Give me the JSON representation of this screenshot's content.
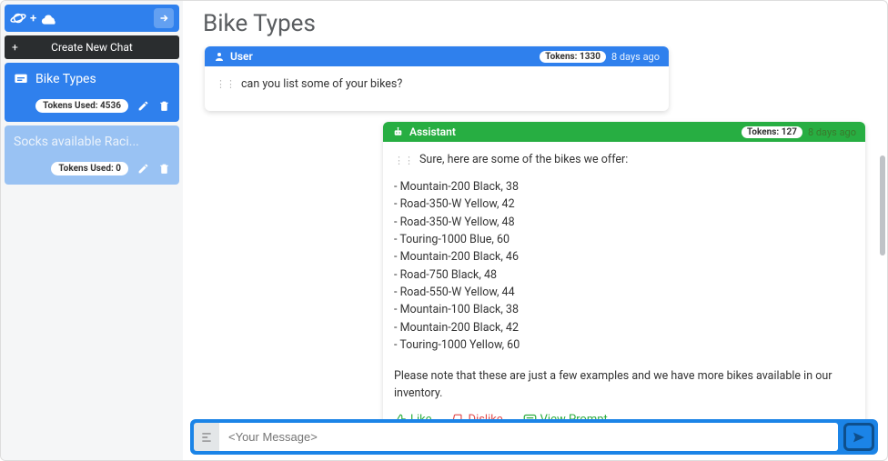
{
  "sidebar": {
    "new_chat_label": "Create New Chat",
    "chats": [
      {
        "title": "Bike Types",
        "tokens_label": "Tokens Used: 4536",
        "active": true
      },
      {
        "title": "Socks available Raci...",
        "tokens_label": "Tokens Used: 0",
        "active": false
      }
    ]
  },
  "page": {
    "title": "Bike Types"
  },
  "thread": {
    "user": {
      "role_label": "User",
      "tokens_badge": "Tokens: 1330",
      "timestamp": "8 days ago",
      "text": "can you list some of your bikes?"
    },
    "assistant": {
      "role_label": "Assistant",
      "tokens_badge": "Tokens: 127",
      "timestamp": "8 days ago",
      "intro": "Sure, here are some of the bikes we offer:",
      "bikes": [
        "Mountain-200 Black, 38",
        "Road-350-W Yellow, 42",
        "Road-350-W Yellow, 48",
        "Touring-1000 Blue, 60",
        "Mountain-200 Black, 46",
        "Road-750 Black, 48",
        "Road-550-W Yellow, 44",
        "Mountain-100 Black, 38",
        "Mountain-200 Black, 42",
        "Touring-1000 Yellow, 60"
      ],
      "footer_note": "Please note that these are just a few examples and we have more bikes available in our inventory.",
      "actions": {
        "like": "Like",
        "dislike": "Dislike",
        "view_prompt": "View Prompt"
      }
    }
  },
  "composer": {
    "placeholder": "<Your Message>"
  }
}
